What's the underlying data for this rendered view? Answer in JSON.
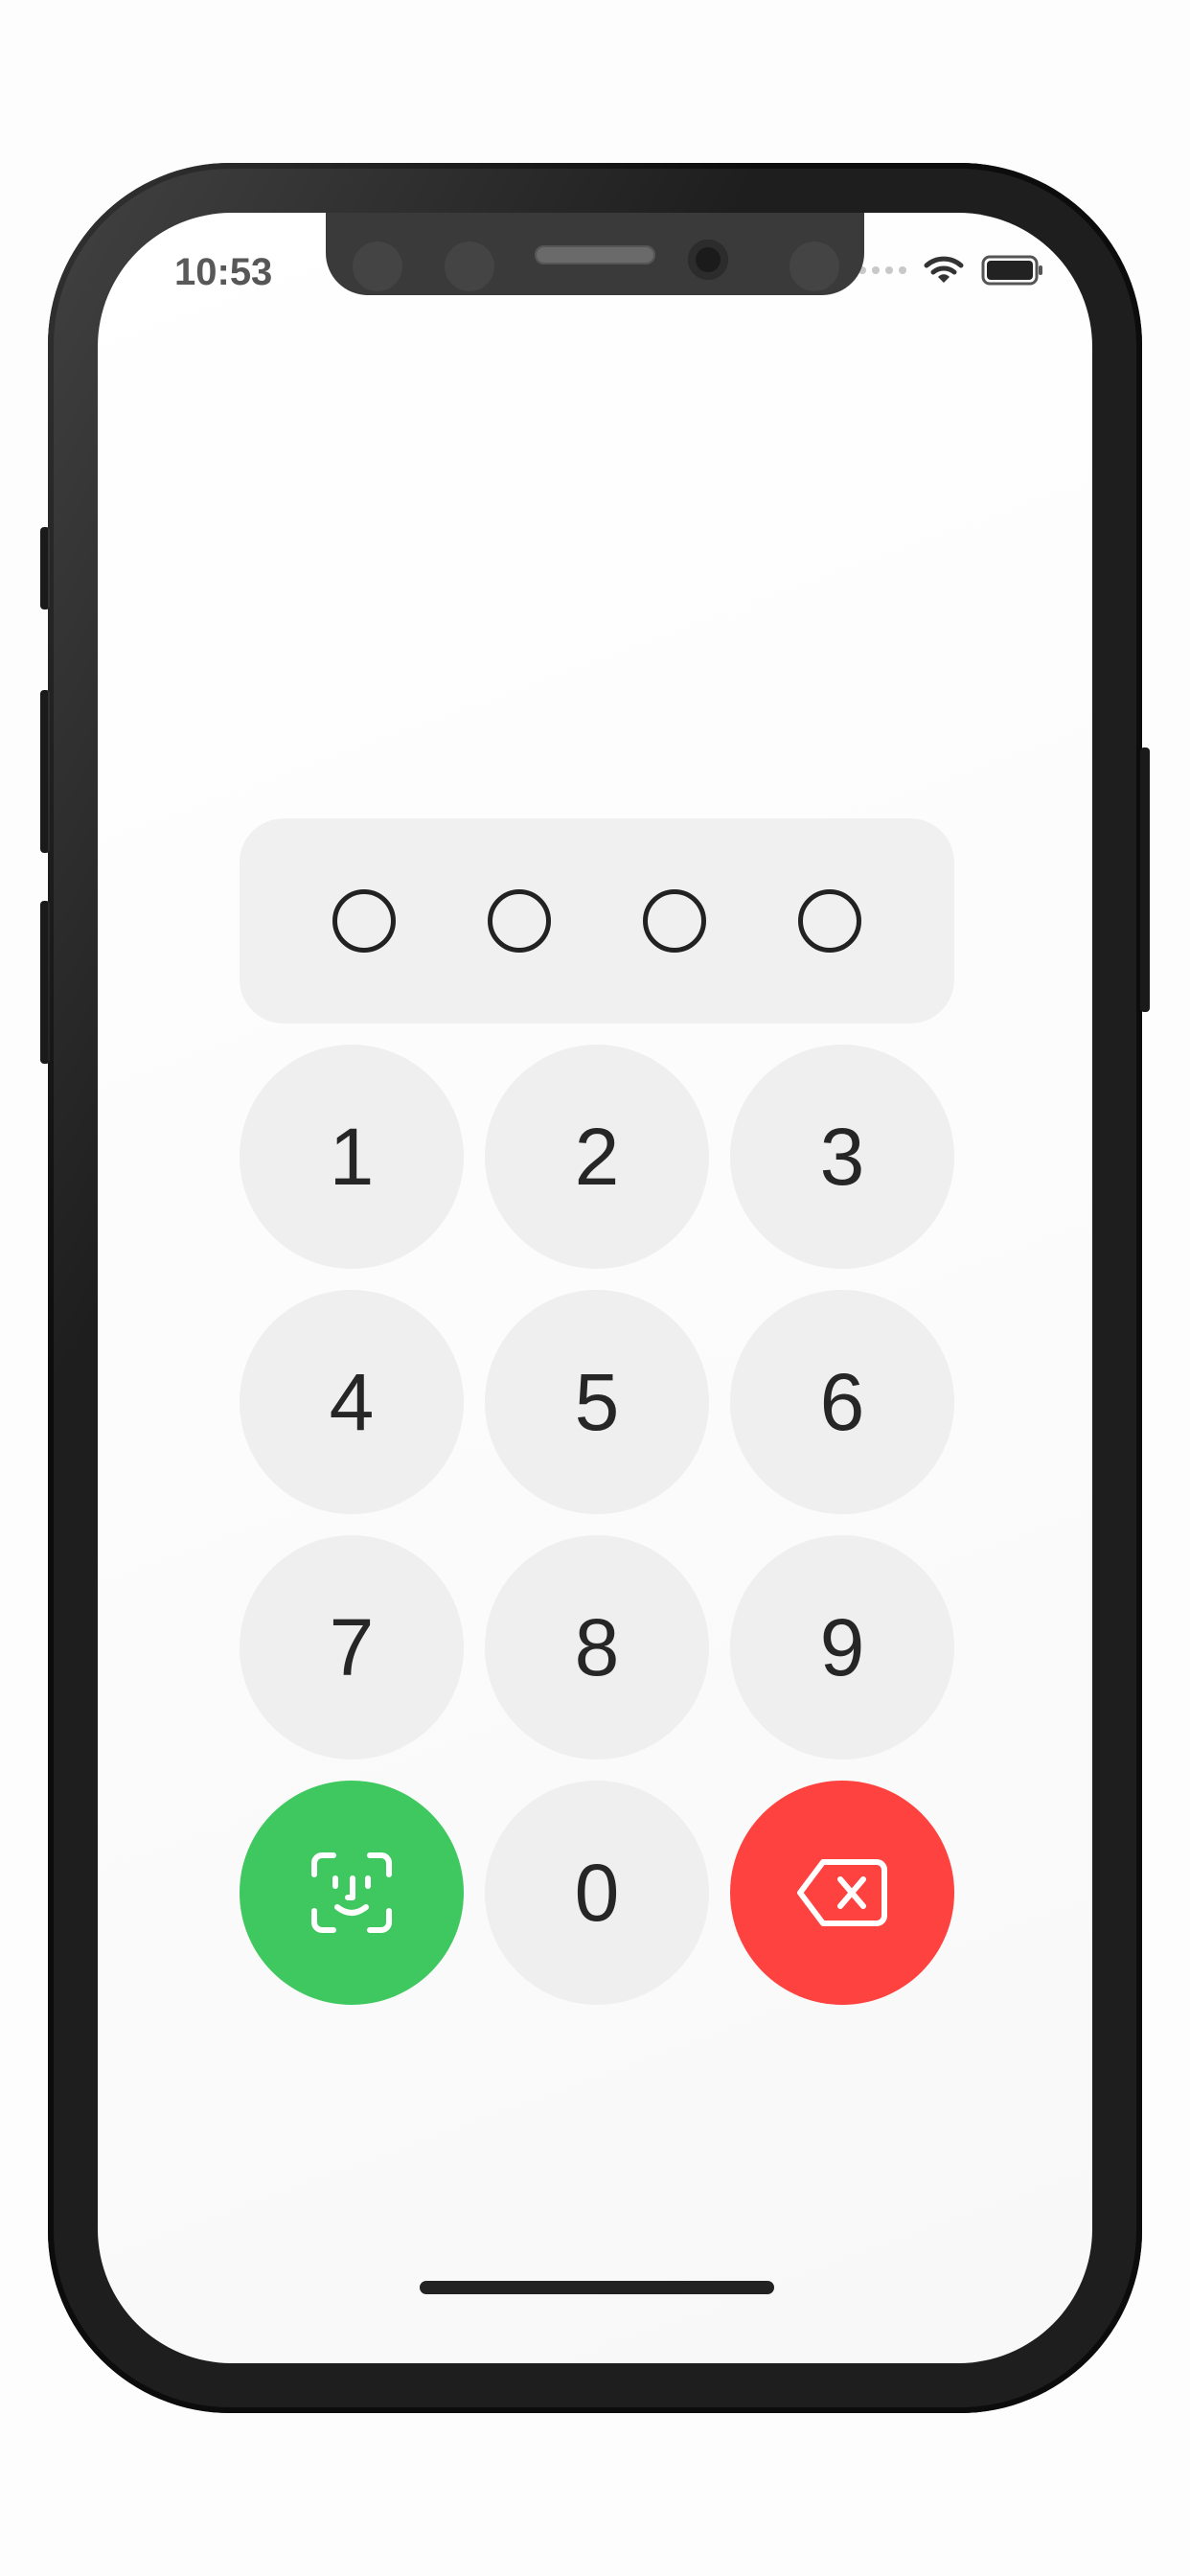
{
  "status_bar": {
    "time": "10:53",
    "wifi_icon": "wifi-icon",
    "battery_icon": "battery-icon"
  },
  "pin_entry": {
    "length": 4,
    "filled": 0
  },
  "keypad": {
    "keys": [
      "1",
      "2",
      "3",
      "4",
      "5",
      "6",
      "7",
      "8",
      "9",
      "0"
    ],
    "faceid_icon": "face-id-icon",
    "delete_icon": "delete-backspace-icon"
  },
  "colors": {
    "faceid_accent": "#3fc85f",
    "delete_accent": "#fd423f",
    "key_background": "#efefef",
    "pin_panel_background": "#f0f0f0"
  }
}
